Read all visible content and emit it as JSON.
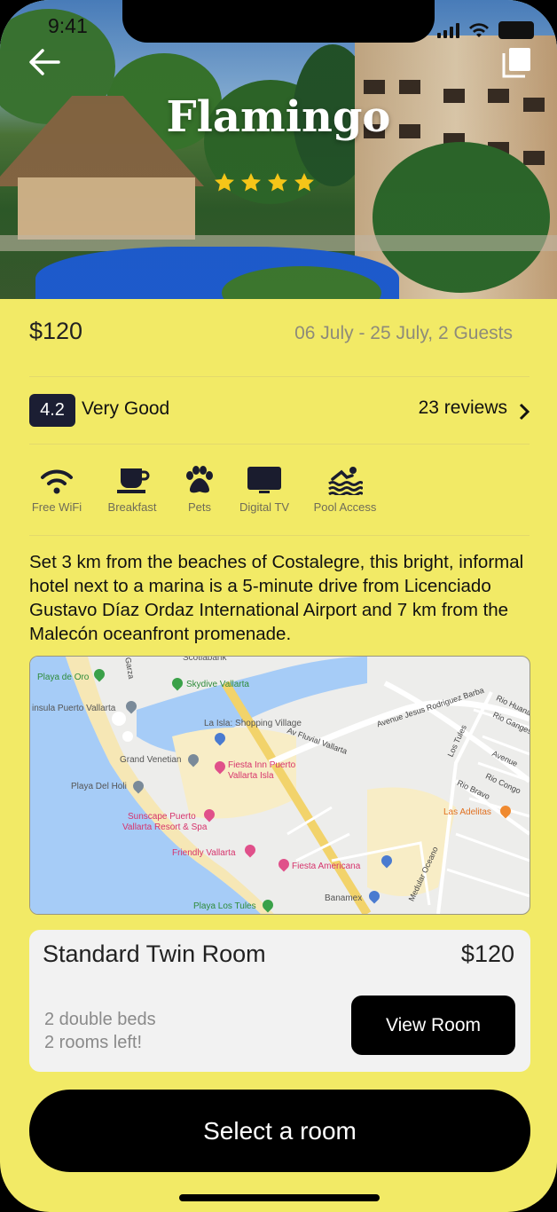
{
  "status": {
    "time": "9:41"
  },
  "hotel": {
    "name": "Flamingo",
    "stars": 4
  },
  "booking": {
    "price": "$120",
    "dates": "06 July - 25 July, 2 Guests"
  },
  "rating": {
    "score": "4.2",
    "label": "Very Good",
    "reviews": "23 reviews"
  },
  "amenities": [
    {
      "icon": "wifi-icon",
      "label": "Free WiFi"
    },
    {
      "icon": "coffee-cup-icon",
      "label": "Breakfast"
    },
    {
      "icon": "paw-icon",
      "label": "Pets"
    },
    {
      "icon": "tv-icon",
      "label": "Digital TV"
    },
    {
      "icon": "swimmer-icon",
      "label": "Pool Access"
    }
  ],
  "description": "Set 3 km from the beaches of Costalegre, this bright, informal hotel next to a marina is a 5-minute drive from Licenciado Gustavo Díaz Ordaz International Airport and 7 km from the Malecón oceanfront promenade.",
  "map": {
    "places": {
      "playa_de_oro": "Playa de Oro",
      "skydive": "Skydive Vallarta",
      "scotiabank": "Scotiabank",
      "isla": "insula Puerto Vallarta",
      "la_isla": "La Isla: Shopping Village",
      "grand_venetian": "Grand Venetian",
      "fiesta_inn": "Fiesta Inn Puerto",
      "fiesta_inn2": "Vallarta Isla",
      "playa_del_holi": "Playa Del Holi",
      "sunscape": "Sunscape Puerto",
      "sunscape2": "Vallarta Resort & Spa",
      "friendly": "Friendly Vallarta",
      "fiesta_americana": "Fiesta Americana",
      "banamex": "Banamex",
      "playa_los_tules": "Playa Los Tules",
      "las_adelitas": "Las Adelitas"
    },
    "roads": {
      "av_fluvial": "Av Fluvial Vallarta",
      "jesus_rodriguez": "Avenue Jesus Rodriguez Barba",
      "avenue": "Avenue",
      "garza": "Garza",
      "rio_huana": "Rio Huana",
      "rio_ganges": "Rio Ganges",
      "rio_congo": "Rio Congo",
      "rio_bravo": "Rio Bravo",
      "rio_tules": "Los Tules",
      "oceano": "Medular Oceano"
    }
  },
  "room": {
    "title": "Standard Twin Room",
    "price": "$120",
    "beds": "2 double beds",
    "availability": "2 rooms left!",
    "view_button": "View Room"
  },
  "cta": {
    "select_room": "Select a room"
  },
  "colors": {
    "background": "#f2ea66",
    "badge": "#1b1e33",
    "star": "#f5c518",
    "button": "#000000"
  }
}
